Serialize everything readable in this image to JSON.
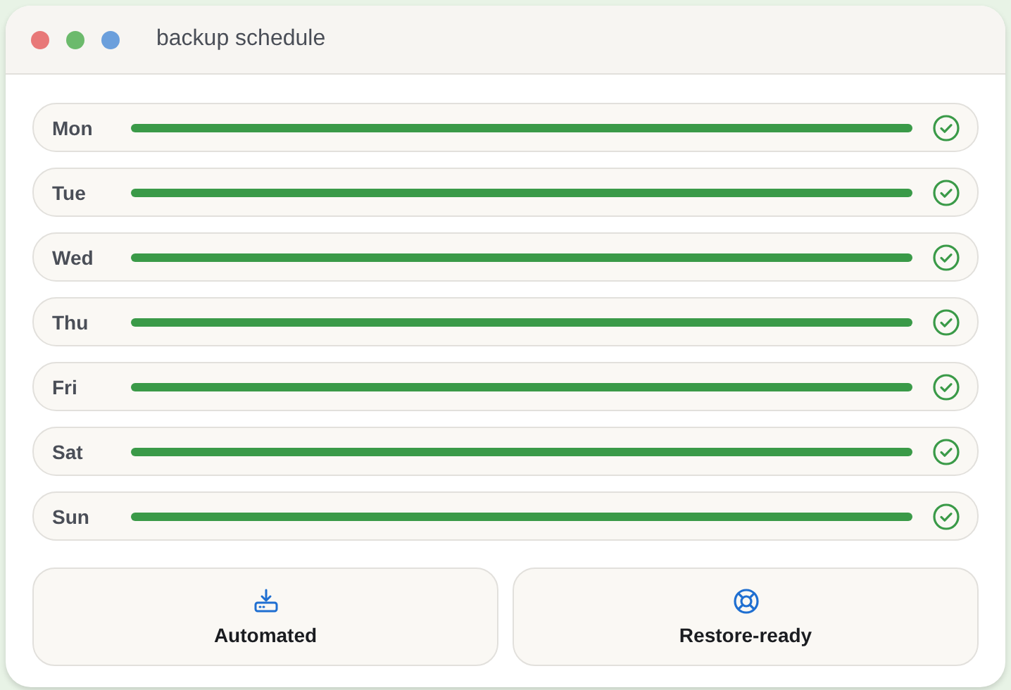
{
  "window": {
    "title": "backup schedule"
  },
  "days": [
    {
      "label": "Mon",
      "done": true
    },
    {
      "label": "Tue",
      "done": true
    },
    {
      "label": "Wed",
      "done": true
    },
    {
      "label": "Thu",
      "done": true
    },
    {
      "label": "Fri",
      "done": true
    },
    {
      "label": "Sat",
      "done": true
    },
    {
      "label": "Sun",
      "done": true
    }
  ],
  "features": [
    {
      "label": "Automated",
      "kind": "download"
    },
    {
      "label": "Restore-ready",
      "kind": "lifebuoy"
    }
  ]
}
